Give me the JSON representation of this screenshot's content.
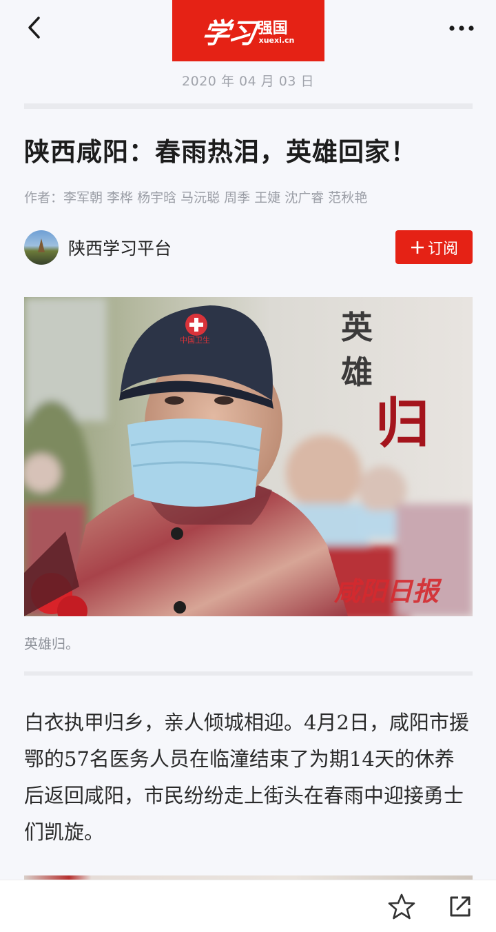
{
  "header": {
    "logo_script": "学习",
    "logo_cn": "强国",
    "logo_url": "xuexi.cn",
    "date": "2020 年 04 月 03 日"
  },
  "article": {
    "title": "陕西咸阳：春雨热泪，英雄回家！",
    "authors": "作者：李军朝 李桦 杨宇晗 马沅聪 周季 王婕 沈广睿 范秋艳",
    "source_name": "陕西学习平台",
    "subscribe_label": "订阅",
    "photo": {
      "cap_text": "中国卫生",
      "overlay_1": "英",
      "overlay_2": "雄",
      "overlay_3": "归",
      "watermark": "咸阳日报"
    },
    "caption": "英雄归。",
    "paragraph": "白衣执甲归乡，亲人倾城相迎。4月2日，咸阳市援鄂的57名医务人员在临潼结束了为期14天的休养后返回咸阳，市民纷纷走上街头在春雨中迎接勇士们凯旋。"
  },
  "icons": {
    "back": "chevron-left-icon",
    "more": "more-horizontal-icon",
    "plus": "plus-icon",
    "star": "star-outline-icon",
    "share": "external-link-icon"
  },
  "colors": {
    "brand_red": "#e52215",
    "background": "#f6f7fb",
    "muted_text": "#9b9ea6"
  }
}
